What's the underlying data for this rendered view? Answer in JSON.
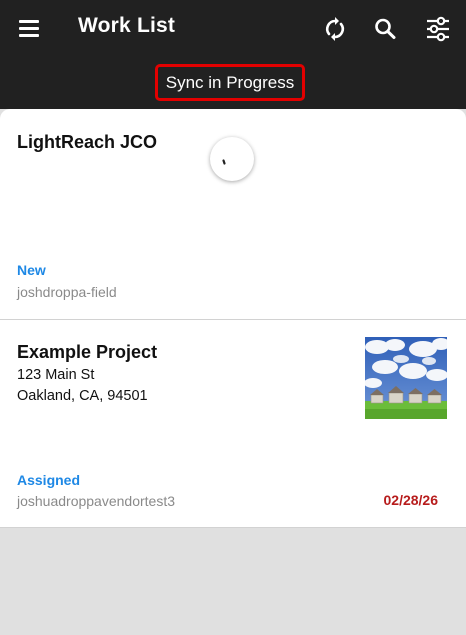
{
  "header": {
    "title": "Work List",
    "sync_status": "Sync in Progress",
    "icons": [
      "menu-icon",
      "sync-icon",
      "search-icon",
      "filter-icon"
    ]
  },
  "work_items": [
    {
      "title": "LightReach JCO",
      "status": "New",
      "assignee": "joshdroppa-field",
      "loading_indicator": "spinner"
    },
    {
      "title": "Example Project",
      "address_line1": "123 Main St",
      "address_line2": "Oakland, CA, 94501",
      "status": "Assigned",
      "assignee": "joshuadroppavendortest3",
      "due_date": "02/28/26",
      "thumbnail": "house-photo"
    }
  ],
  "colors": {
    "app_bar": "#212121",
    "status_text": "#1e88e5",
    "due_date": "#b71c1c",
    "highlight_border": "#e30000",
    "background": "#e0e0e0"
  }
}
